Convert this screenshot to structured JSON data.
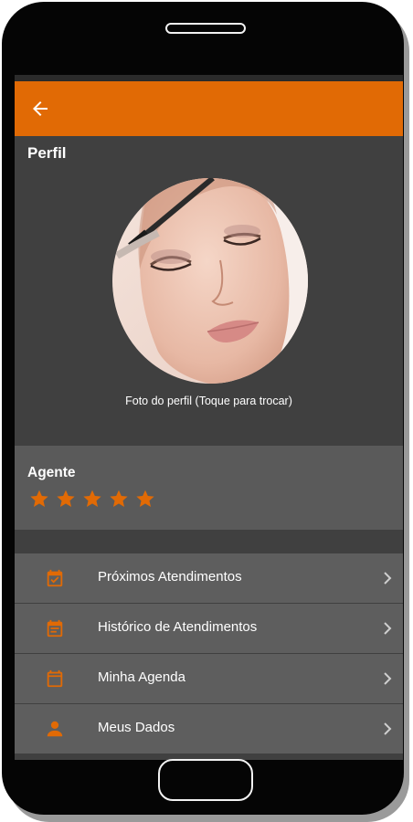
{
  "page": {
    "title": "Perfil"
  },
  "profile": {
    "photo_caption": "Foto do perfil (Toque para trocar)"
  },
  "agent": {
    "label": "Agente",
    "rating": 5,
    "rating_max": 5,
    "star_color": "#e16a05"
  },
  "menu": {
    "items": [
      {
        "label": "Próximos Atendimentos",
        "icon": "calendar-check-icon"
      },
      {
        "label": "Histórico de Atendimentos",
        "icon": "calendar-list-icon"
      },
      {
        "label": "Minha Agenda",
        "icon": "calendar-icon"
      },
      {
        "label": "Meus Dados",
        "icon": "person-icon"
      }
    ]
  },
  "colors": {
    "accent": "#e16a05",
    "background": "#404040",
    "card": "#5a5a5a",
    "menu_item": "#5e5e5e"
  }
}
